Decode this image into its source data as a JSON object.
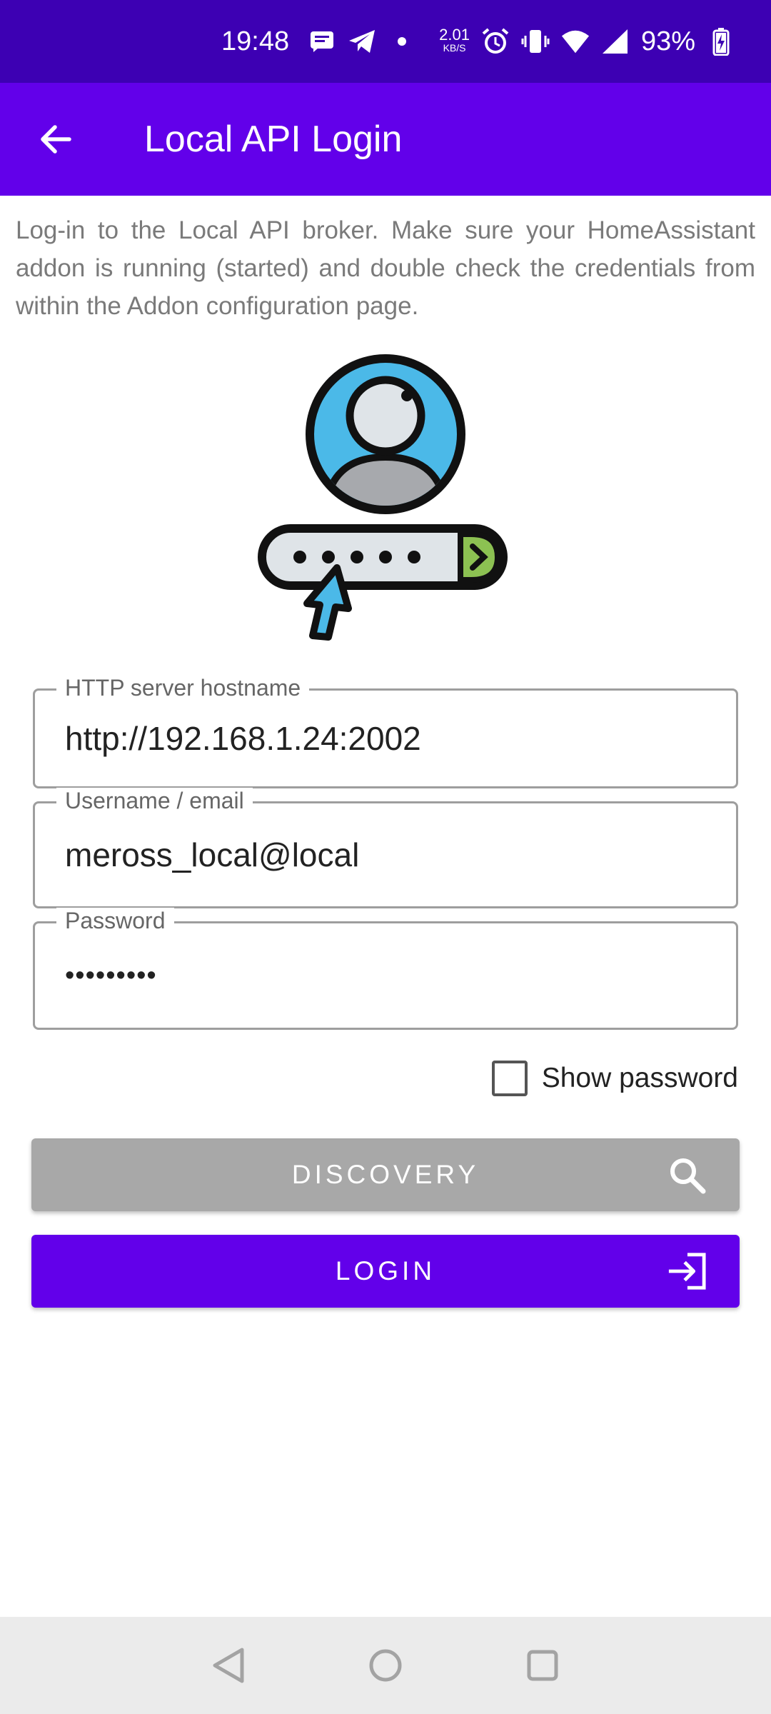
{
  "status_bar": {
    "time": "19:48",
    "net_speed_value": "2.01",
    "net_speed_unit": "KB/S",
    "battery": "93%"
  },
  "app_bar": {
    "title": "Local API Login"
  },
  "description": "Log-in to the Local API broker. Make sure your HomeAssistant addon is running (started) and double check the credentials from within the Addon configuration page.",
  "form": {
    "hostname": {
      "label": "HTTP server hostname",
      "value": "http://192.168.1.24:2002"
    },
    "username": {
      "label": "Username / email",
      "value": "meross_local@local"
    },
    "password": {
      "label": "Password",
      "value": "•••••••••"
    },
    "show_password": {
      "label": "Show password",
      "checked": false
    }
  },
  "buttons": {
    "discovery": "DISCOVERY",
    "login": "LOGIN"
  },
  "colors": {
    "status_bar": "#3d00b3",
    "app_bar": "#6200ea",
    "login_button": "#6200ea",
    "discovery_button": "#a8a8a8"
  },
  "icons": {
    "back": "arrow-left-icon",
    "discovery": "search-icon",
    "login": "login-icon",
    "illustration": "user-password-illustration"
  }
}
